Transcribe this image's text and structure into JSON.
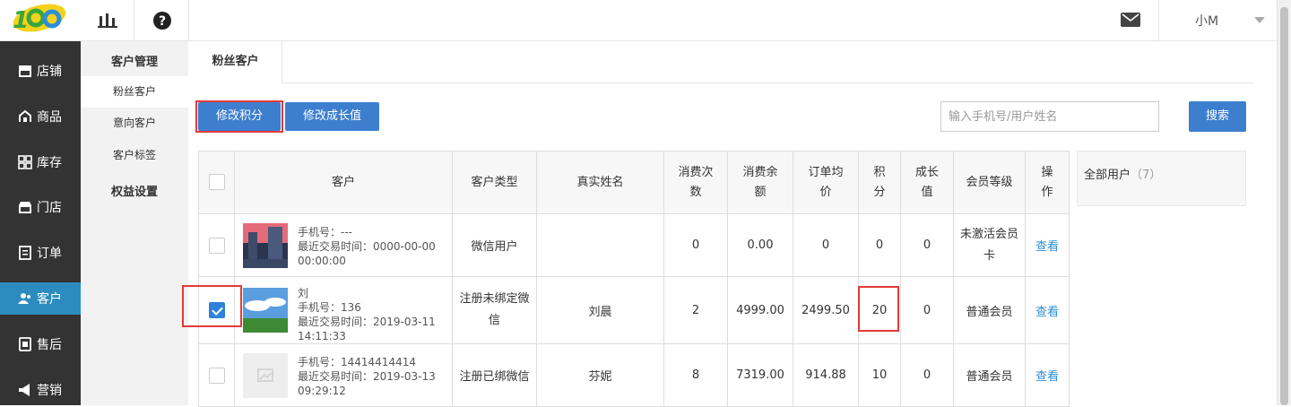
{
  "top": {
    "user_name": "小M"
  },
  "sidebar": {
    "items": [
      {
        "label": "店铺",
        "icon": "store-icon"
      },
      {
        "label": "商品",
        "icon": "goods-icon"
      },
      {
        "label": "库存",
        "icon": "inventory-icon"
      },
      {
        "label": "门店",
        "icon": "shop-icon"
      },
      {
        "label": "订单",
        "icon": "order-icon"
      },
      {
        "label": "客户",
        "icon": "customer-icon",
        "active": true
      },
      {
        "label": "售后",
        "icon": "aftersale-icon"
      },
      {
        "label": "营销",
        "icon": "marketing-icon"
      }
    ],
    "active_color": "#2d8cbf"
  },
  "subnav": {
    "group1": "客户管理",
    "items": [
      "粉丝客户",
      "意向客户",
      "客户标签"
    ],
    "group2": "权益设置"
  },
  "tabs": {
    "active": "粉丝客户"
  },
  "toolbar": {
    "edit_points": "修改积分",
    "edit_growth": "修改成长值",
    "search_placeholder": "输入手机号/用户姓名",
    "search_button": "搜索"
  },
  "table": {
    "headers": {
      "customer": "客户",
      "type": "客户类型",
      "real_name": "真实姓名",
      "count_l1": "消费次",
      "count_l2": "数",
      "amount_l1": "消费余",
      "amount_l2": "额",
      "avg_l1": "订单均",
      "avg_l2": "价",
      "points_l1": "积",
      "points_l2": "分",
      "growth_l1": "成长",
      "growth_l2": "值",
      "level": "会员等级",
      "op_l1": "操",
      "op_l2": "作"
    },
    "rows": [
      {
        "checked": false,
        "line1": "手机号：---",
        "line2": "最近交易时间：0000-00-00",
        "line3": "00:00:00",
        "type_l1": "微信用户",
        "type_l2": "",
        "real_name": "",
        "count": "0",
        "amount": "0.00",
        "avg": "0",
        "points": "0",
        "growth": "0",
        "level_l1": "未激活会员",
        "level_l2": "卡",
        "op": "查看"
      },
      {
        "checked": true,
        "line0": "刘",
        "line1": "手机号：136",
        "line2": "最近交易时间：2019-03-11",
        "line3": "14:11:33",
        "type_l1": "注册未绑定微",
        "type_l2": "信",
        "real_name": "刘晨",
        "count": "2",
        "amount": "4999.00",
        "avg": "2499.50",
        "points": "20",
        "growth": "0",
        "level_l1": "普通会员",
        "level_l2": "",
        "op": "查看"
      },
      {
        "checked": false,
        "line1": "手机号：14414414414",
        "line2": "最近交易时间：2019-03-13",
        "line3": "09:29:12",
        "type_l1": "注册已绑微信",
        "type_l2": "",
        "real_name": "芬妮",
        "count": "8",
        "amount": "7319.00",
        "avg": "914.88",
        "points": "10",
        "growth": "0",
        "level_l1": "普通会员",
        "level_l2": "",
        "op": "查看"
      }
    ]
  },
  "side_panel": {
    "label": "全部用户",
    "count": "（7）"
  }
}
